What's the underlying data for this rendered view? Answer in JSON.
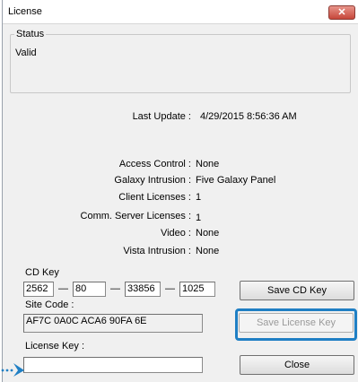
{
  "window": {
    "title": "License",
    "close_glyph": "✕"
  },
  "status": {
    "legend": "Status",
    "value": "Valid"
  },
  "last_update": {
    "label": "Last Update :",
    "value": "4/29/2015 8:56:36 AM"
  },
  "licenses": [
    {
      "label": "Access Control :",
      "value": "None"
    },
    {
      "label": "Galaxy Intrusion :",
      "value": "Five Galaxy Panel"
    },
    {
      "label": "Client Licenses :",
      "value": "1"
    },
    {
      "label": "Comm. Server Licenses :",
      "value": "1"
    },
    {
      "label": "Video :",
      "value": "None"
    },
    {
      "label": "Vista Intrusion :",
      "value": "None"
    }
  ],
  "cd_key": {
    "label": "CD Key",
    "parts": [
      "2562",
      "80",
      "33856",
      "1025"
    ],
    "separator": "—"
  },
  "site_code": {
    "label": "Site Code :",
    "value": "AF7C 0A0C ACA6 90FA 6E"
  },
  "license_key": {
    "label": "License Key :",
    "value": ""
  },
  "buttons": {
    "save_cd_key": "Save CD Key",
    "save_license_key": "Save License Key",
    "close": "Close"
  },
  "annotation": {
    "highlight_color": "#1f7fc4",
    "arrow_icon": "dotted-arrow-icon"
  }
}
